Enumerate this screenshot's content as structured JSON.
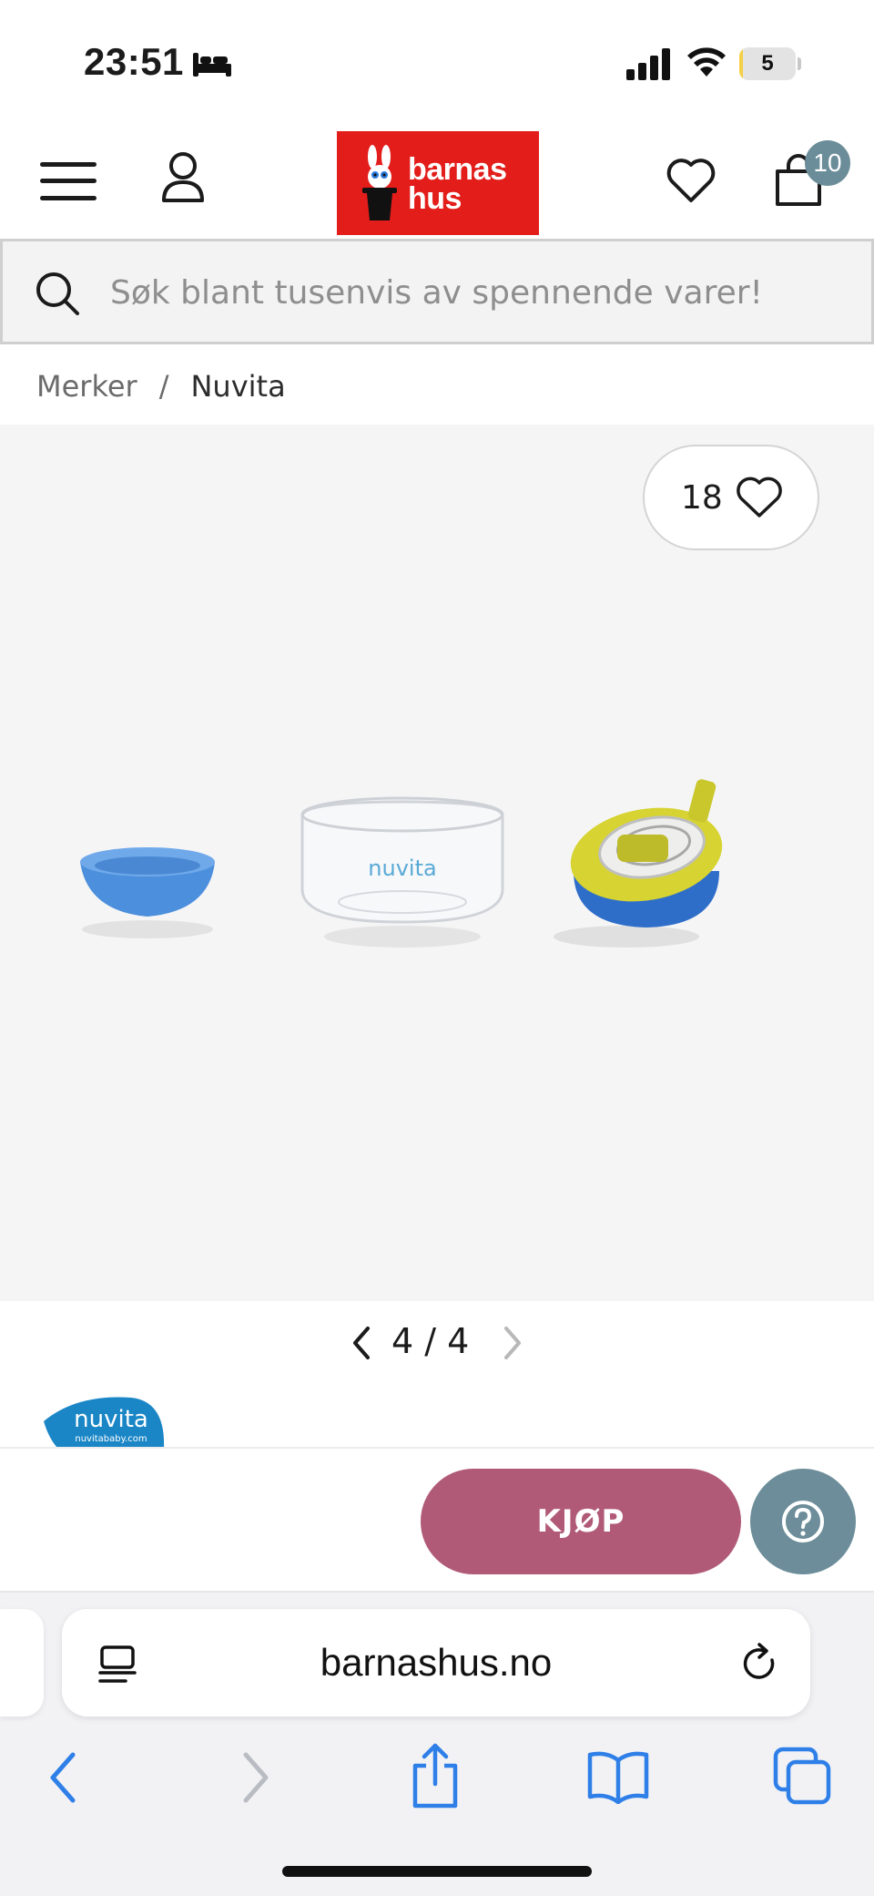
{
  "status_bar": {
    "time": "23:51",
    "battery_level": "5",
    "battery_fraction": 0.05,
    "icons": [
      "bed-icon",
      "signal-icon",
      "wifi-icon",
      "battery-icon"
    ]
  },
  "header": {
    "logo_text_line1": "barnas",
    "logo_text_line2": "hus",
    "cart_count": "10",
    "brand_color": "#e21d1a",
    "icons": [
      "hamburger-menu-icon",
      "account-icon",
      "heart-icon",
      "shopping-bag-icon"
    ]
  },
  "search": {
    "placeholder": "Søk blant tusenvis av spennende varer!"
  },
  "breadcrumb": {
    "items": [
      {
        "label": "Merker"
      },
      {
        "label": "Nuvita"
      }
    ],
    "separator": "/"
  },
  "gallery": {
    "favorite_count": "18",
    "current_page": "4",
    "total_pages": "4",
    "pager_text": "4 / 4",
    "image_text": "nuvita"
  },
  "brand": {
    "logo_text": "nuvita",
    "logo_subtext": "nuvitababy.com"
  },
  "purchase": {
    "buy_label": "KJØP",
    "buy_color": "#b05a78",
    "help_color": "#6c8d99"
  },
  "browser": {
    "address": "barnashus.no",
    "toolbar_icons": [
      "back-icon",
      "forward-icon",
      "share-icon",
      "bookmarks-icon",
      "tabs-icon"
    ],
    "accent": "#2f7fe8"
  }
}
